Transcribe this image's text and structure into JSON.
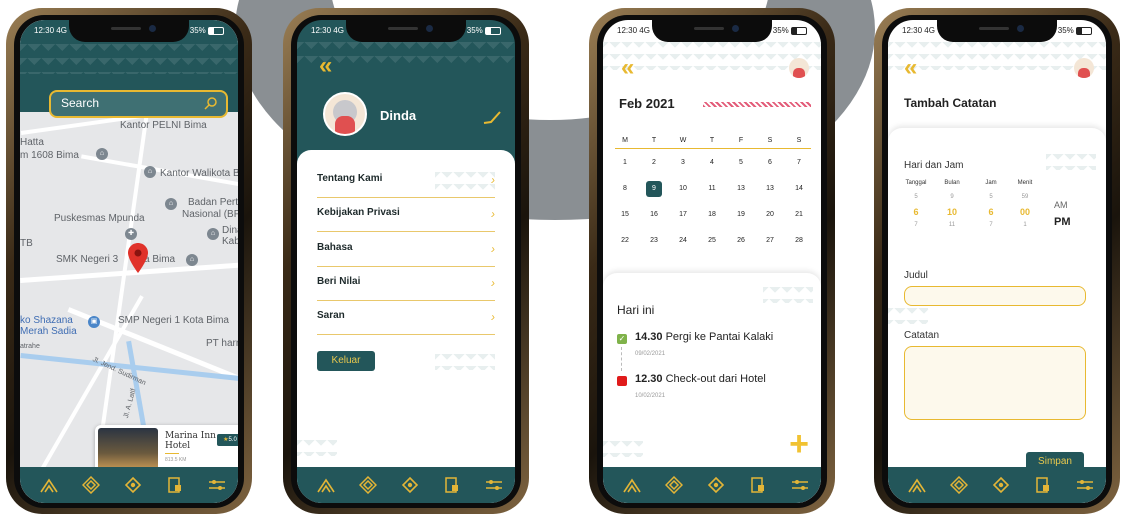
{
  "status": {
    "time": "12:30 4G",
    "battery": "35%"
  },
  "phone1": {
    "search_placeholder": "Search",
    "map_labels": [
      "Kantor PELNI Bima",
      "Hatta",
      "m 1608 Bima",
      "Kantor Walikota B",
      "Badan Pertan",
      "Nasional (BP",
      "Puskesmas Mpunda",
      "Dina",
      "Kabu",
      "TB",
      "SMK Negeri 3",
      "a Bima",
      "ko Shazana",
      "Merah Sadia",
      "SMP Negeri 1 Kota Bima",
      "PT harr",
      "atrahe",
      "Jl. Jend. Sudirman",
      "Jl. A. Latif",
      "K"
    ],
    "hotel_card": {
      "name_line1": "Marina Inn",
      "name_line2": "Hotel",
      "sub": "813.5 KM",
      "rating": "5.0"
    }
  },
  "phone2": {
    "profile_name": "Dinda",
    "menu": [
      {
        "label": "Tentang Kami"
      },
      {
        "label": "Kebijakan Privasi"
      },
      {
        "label": "Bahasa"
      },
      {
        "label": "Beri Nilai"
      },
      {
        "label": "Saran"
      }
    ],
    "logout_label": "Keluar"
  },
  "phone3": {
    "month_title": "Feb  2021",
    "weekdays": [
      "M",
      "T",
      "W",
      "T",
      "F",
      "S",
      "S"
    ],
    "weeks": [
      [
        "1",
        "2",
        "3",
        "4",
        "5",
        "6",
        "7"
      ],
      [
        "8",
        "9",
        "10",
        "11",
        "13",
        "13",
        "14"
      ],
      [
        "15",
        "16",
        "17",
        "18",
        "19",
        "20",
        "21"
      ],
      [
        "22",
        "23",
        "24",
        "25",
        "26",
        "27",
        "28"
      ]
    ],
    "selected_day": "9",
    "today_title": "Hari ini",
    "events": [
      {
        "time": "14.30",
        "title": "Pergi ke Pantai Kalaki",
        "date": "09/02/2021",
        "color": "#7fb24a"
      },
      {
        "time": "12.30",
        "title": "Check-out dari Hotel",
        "date": "10/02/2021",
        "color": "#e01b1b"
      }
    ],
    "add_symbol": "+"
  },
  "phone4": {
    "title": "Tambah Catatan",
    "datetime_label": "Hari dan Jam",
    "col_headers": [
      "Tanggal",
      "Bulan",
      "Jam",
      "Menit"
    ],
    "picker_top": [
      "5",
      "9",
      "5",
      "59"
    ],
    "picker_selected": [
      "6",
      "10",
      "6",
      "00"
    ],
    "picker_bottom": [
      "7",
      "11",
      "7",
      "1"
    ],
    "am_label": "AM",
    "pm_label": "PM",
    "judul_label": "Judul",
    "catatan_label": "Catatan",
    "save_label": "Simpan"
  },
  "colors": {
    "teal": "#23565a",
    "gold": "#e8b931"
  },
  "nav_icons": [
    "mountain-icon",
    "diamond-pattern-icon",
    "map-pin-diamond-icon",
    "document-icon",
    "sliders-icon"
  ]
}
